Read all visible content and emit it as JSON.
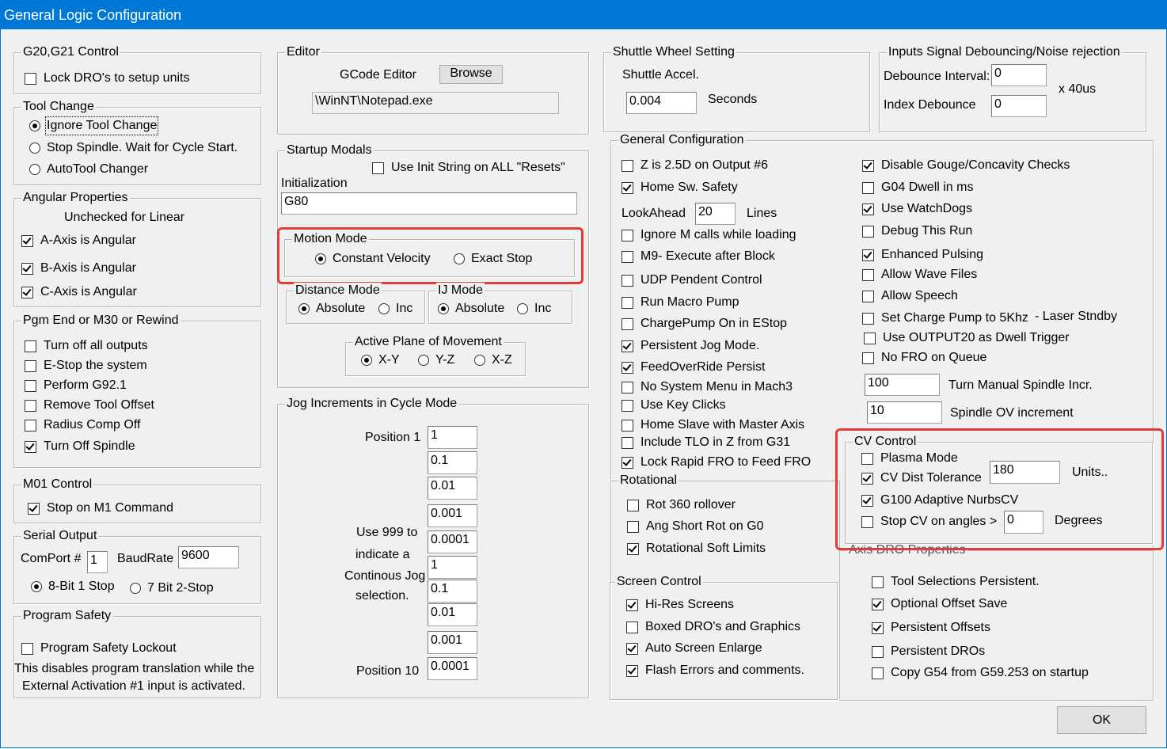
{
  "window": {
    "title": "General Logic Configuration"
  },
  "g20": {
    "title": "G20,G21 Control",
    "lock": {
      "label": "Lock DRO's to setup units",
      "checked": false
    }
  },
  "tool_change": {
    "title": "Tool Change",
    "options": [
      "Ignore Tool Change",
      "Stop Spindle. Wait for Cycle Start.",
      "AutoTool Changer"
    ],
    "selected": 0
  },
  "angular": {
    "title": "Angular Properties",
    "note": "Unchecked for Linear",
    "a": "A-Axis is Angular",
    "b": "B-Axis is Angular",
    "c": "C-Axis is Angular"
  },
  "pgm_end": {
    "title": "Pgm End or M30 or Rewind",
    "items": [
      "Turn off all outputs",
      "E-Stop the system",
      "Perform G92.1",
      "Remove Tool Offset",
      "Radius Comp Off",
      "Turn Off Spindle"
    ]
  },
  "m01": {
    "title": "M01 Control",
    "item": "Stop on M1 Command"
  },
  "serial": {
    "title": "Serial Output",
    "comport_label": "ComPort #",
    "comport": "1",
    "baud_label": "BaudRate",
    "baud": "9600",
    "opt1": "8-Bit 1 Stop",
    "opt2": "7 Bit 2-Stop"
  },
  "safety": {
    "title": "Program Safety",
    "lockout": "Program Safety Lockout",
    "note1": "This disables program translation while the",
    "note2": "External Activation #1 input is activated."
  },
  "editor": {
    "title": "Editor",
    "label": "GCode Editor",
    "browse": "Browse",
    "path": "\\WinNT\\Notepad.exe"
  },
  "startup": {
    "title": "Startup Modals",
    "init_all": "Use Init String on ALL  \"Resets\"",
    "init_label": "Initialization",
    "init_value": "G80"
  },
  "motion": {
    "title": "Motion Mode",
    "cv": "Constant Velocity",
    "es": "Exact Stop"
  },
  "distance": {
    "title": "Distance Mode",
    "abs": "Absolute",
    "inc": "Inc"
  },
  "ij": {
    "title": "IJ Mode",
    "abs": "Absolute",
    "inc": "Inc"
  },
  "plane": {
    "title": "Active Plane of Movement",
    "xy": "X-Y",
    "yz": "Y-Z",
    "xz": "X-Z"
  },
  "jog": {
    "title": "Jog Increments in Cycle Mode",
    "pos1": "Position 1",
    "pos10": "Position 10",
    "note1": "Use 999 to",
    "note2": "indicate a",
    "note3": "Continous Jog",
    "note4": "selection.",
    "values": [
      "1",
      "0.1",
      "0.01",
      "0.001",
      "0.0001",
      "1",
      "0.1",
      "0.01",
      "0.001",
      "0.0001"
    ]
  },
  "shuttle": {
    "title": "Shuttle Wheel Setting",
    "label": "Shuttle Accel.",
    "value": "0.004",
    "unit": "Seconds"
  },
  "debounce": {
    "title": "Inputs Signal Debouncing/Noise rejection",
    "interval_label": "Debounce Interval:",
    "interval": "0",
    "index_label": "Index Debounce",
    "index": "0",
    "unit": "x 40us"
  },
  "general": {
    "title": "General Configuration",
    "z25": "Z is 2.5D on Output #6",
    "home_safety": "Home Sw. Safety",
    "lookahead_label": "LookAhead",
    "lookahead": "20",
    "lines": "Lines",
    "ignore_m": "Ignore M calls while loading",
    "m9": "M9- Execute after Block",
    "udp": "UDP Pendent Control",
    "macro_pump": "Run Macro Pump",
    "chargepump": "ChargePump On in EStop",
    "persist_jog": "Persistent Jog Mode.",
    "feed_persist": "FeedOverRide Persist",
    "no_sysmenu": "No System Menu in Mach3",
    "key_clicks": "Use Key Clicks",
    "home_slave": "Home Slave with Master Axis",
    "tlo": "Include TLO in Z from G31",
    "lock_rapid": "Lock Rapid FRO to Feed FRO",
    "gouge": "Disable Gouge/Concavity Checks",
    "g04": "G04 Dwell in ms",
    "watchdogs": "Use WatchDogs",
    "debug": "Debug This Run",
    "pulsing": "Enhanced Pulsing",
    "wave": "Allow Wave Files",
    "speech": "Allow Speech",
    "charge5k": "Set Charge Pump to 5Khz",
    "laser": "- Laser Stndby",
    "out20": "Use OUTPUT20 as Dwell Trigger",
    "nofro": "No FRO on Queue",
    "spindle_incr": "100",
    "spindle_incr_label": "Turn Manual Spindle Incr.",
    "spindle_ov": "10",
    "spindle_ov_label": "Spindle OV increment"
  },
  "rotational": {
    "title": "Rotational",
    "r360": "Rot 360 rollover",
    "ang_short": "Ang Short Rot on G0",
    "soft_limits": "Rotational Soft Limits"
  },
  "screen": {
    "title": "Screen Control",
    "hires": "Hi-Res Screens",
    "boxed": "Boxed DRO's and Graphics",
    "enlarge": "Auto Screen Enlarge",
    "flash": "Flash Errors and comments."
  },
  "cv": {
    "title": "CV Control",
    "plasma": "Plasma Mode",
    "dist_tol": "CV Dist Tolerance",
    "dist_val": "180",
    "units": "Units..",
    "g100": "G100 Adaptive NurbsCV",
    "stop_angles": "Stop CV on angles >",
    "angle_val": "0",
    "degrees": "Degrees"
  },
  "axis_dro": {
    "title": "Axis DRO Properties",
    "tool_sel": "Tool Selections Persistent.",
    "offset_save": "Optional Offset Save",
    "persist_offsets": "Persistent Offsets",
    "persist_dros": "Persistent DROs",
    "copy_g54": "Copy G54 from G59.253 on startup"
  },
  "ok": "OK",
  "highlight_color": "#e13b3b"
}
